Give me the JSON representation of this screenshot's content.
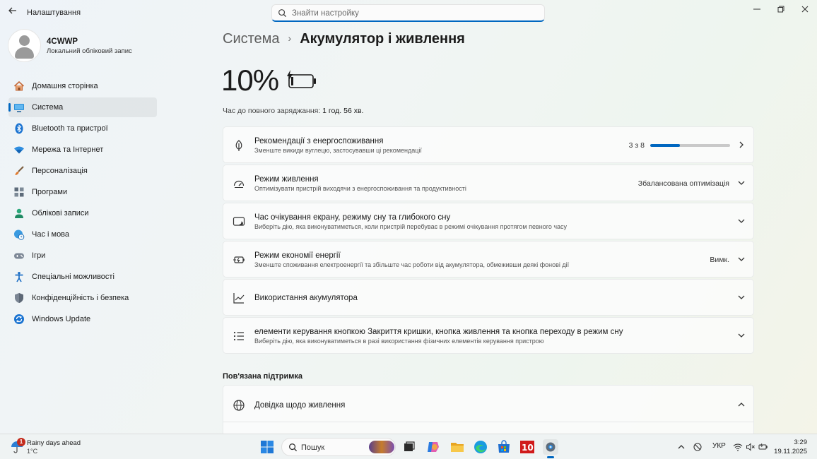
{
  "window": {
    "title": "Налаштування",
    "controls": {
      "minimize": "—",
      "maximize": "❐",
      "close": "✕"
    }
  },
  "search": {
    "placeholder": "Знайти настройку",
    "value": ""
  },
  "profile": {
    "name": "4CWWP",
    "account_type": "Локальний обліковий запис"
  },
  "nav": {
    "items": [
      {
        "label": "Домашня сторінка",
        "icon": "home-icon",
        "active": false
      },
      {
        "label": "Система",
        "icon": "display-icon",
        "active": true
      },
      {
        "label": "Bluetooth та пристрої",
        "icon": "bluetooth-icon",
        "active": false
      },
      {
        "label": "Мережа та Інтернет",
        "icon": "wifi-icon",
        "active": false
      },
      {
        "label": "Персоналізація",
        "icon": "brush-icon",
        "active": false
      },
      {
        "label": "Програми",
        "icon": "apps-icon",
        "active": false
      },
      {
        "label": "Облікові записи",
        "icon": "person-icon",
        "active": false
      },
      {
        "label": "Час і мова",
        "icon": "globe-clock-icon",
        "active": false
      },
      {
        "label": "Ігри",
        "icon": "gamepad-icon",
        "active": false
      },
      {
        "label": "Спеціальні можливості",
        "icon": "accessibility-icon",
        "active": false
      },
      {
        "label": "Конфіденційність і безпека",
        "icon": "shield-icon",
        "active": false
      },
      {
        "label": "Windows Update",
        "icon": "update-icon",
        "active": false
      }
    ]
  },
  "breadcrumb": {
    "parent": "Система",
    "separator": "›",
    "current": "Акумулятор і живлення"
  },
  "battery": {
    "percent_text": "10%",
    "percent": 10,
    "charge_label": "Час до повного заряджання:",
    "charge_value": "1 год. 56 хв."
  },
  "cards": {
    "recommendations": {
      "title": "Рекомендації з енергоспоживання",
      "subtitle": "Зменште викиди вуглецю, застосувавши ці рекомендації",
      "progress_text": "3 з 8",
      "progress_fraction": 0.375
    },
    "power_mode": {
      "title": "Режим живлення",
      "subtitle": "Оптимізувати пристрій виходячи з енергоспоживання та продуктивності",
      "value": "Збалансована оптимізація"
    },
    "sleep": {
      "title": "Час очікування екрану, режиму сну та глибокого сну",
      "subtitle": "Виберіть дію, яка виконуватиметься, коли пристрій перебуває в режимі очікування протягом певного часу"
    },
    "saver": {
      "title": "Режим економії енергії",
      "subtitle": "Зменште споживання електроенергії та збільште час роботи від акумулятора, обмеживши деякі фонові дії",
      "value": "Вимк."
    },
    "usage": {
      "title": "Використання акумулятора"
    },
    "controls": {
      "title": "елементи керування кнопкою Закриття кришки, кнопка живлення та кнопка переходу в режим сну",
      "subtitle": "Виберіть дію, яка виконуватиметься в разі використання фізичних елементів керування пристрою"
    }
  },
  "support": {
    "section_title": "Пов'язана підтримка",
    "help_title": "Довідка щодо живлення"
  },
  "taskbar": {
    "weather": {
      "title": "Rainy days ahead",
      "temp": "1°C",
      "badge": "1"
    },
    "search_label": "Пошук",
    "language": "УКР",
    "time": "3:29",
    "date": "19.11.2025"
  },
  "colors": {
    "accent": "#0067c0"
  }
}
